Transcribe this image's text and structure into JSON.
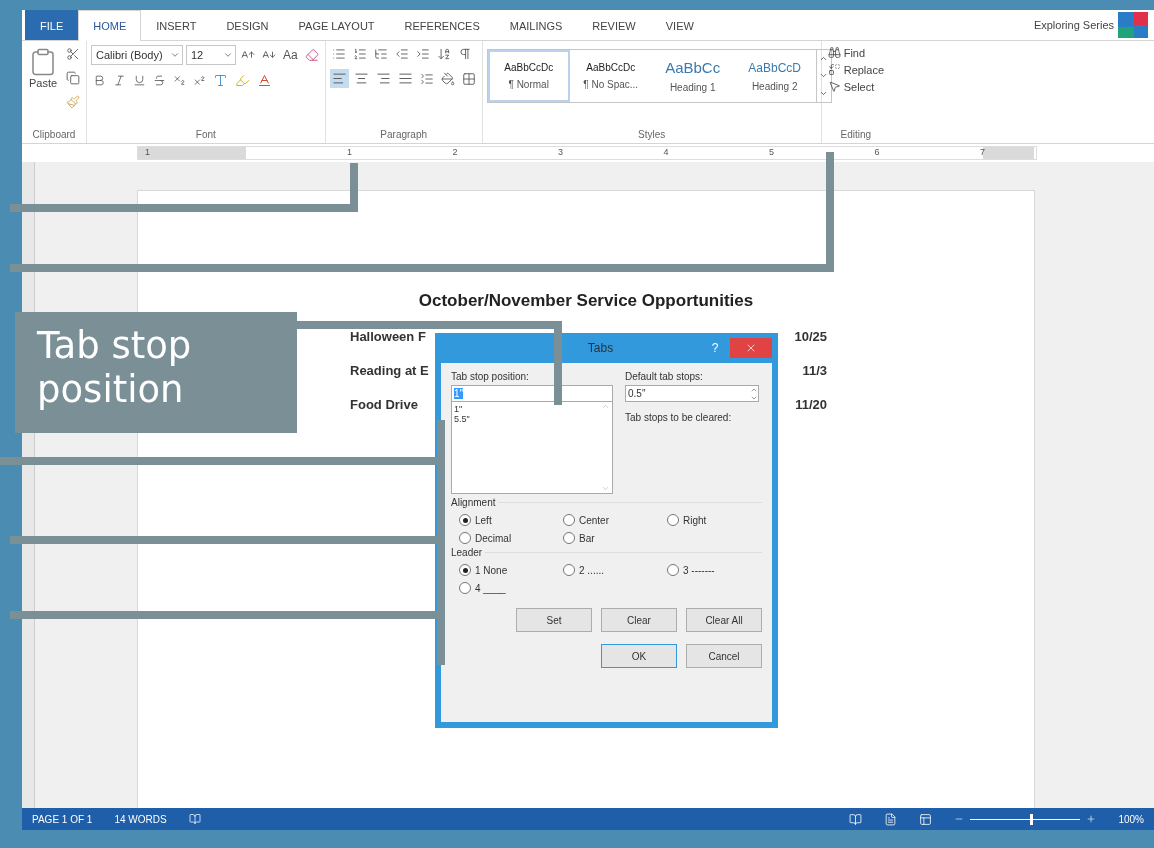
{
  "ribbon_tabs": [
    {
      "label": "FILE",
      "kind": "file",
      "selected": false
    },
    {
      "label": "HOME",
      "kind": "tab",
      "selected": true
    },
    {
      "label": "INSERT",
      "kind": "tab",
      "selected": false
    },
    {
      "label": "DESIGN",
      "kind": "tab",
      "selected": false
    },
    {
      "label": "PAGE LAYOUT",
      "kind": "tab",
      "selected": false
    },
    {
      "label": "REFERENCES",
      "kind": "tab",
      "selected": false
    },
    {
      "label": "MAILINGS",
      "kind": "tab",
      "selected": false
    },
    {
      "label": "REVIEW",
      "kind": "tab",
      "selected": false
    },
    {
      "label": "VIEW",
      "kind": "tab",
      "selected": false
    }
  ],
  "account": {
    "name": "Exploring Series"
  },
  "clipboard": {
    "paste_label": "Paste",
    "group_label": "Clipboard"
  },
  "font": {
    "family": "Calibri (Body)",
    "size": "12",
    "case_label": "Aa",
    "group_label": "Font"
  },
  "paragraph": {
    "group_label": "Paragraph",
    "align": [
      {
        "kind": "left",
        "selected": true
      },
      {
        "kind": "center",
        "selected": false
      },
      {
        "kind": "right",
        "selected": false
      },
      {
        "kind": "justify",
        "selected": false
      }
    ]
  },
  "styles": {
    "group_label": "Styles",
    "items": [
      {
        "preview": "AaBbCcDc",
        "name": "¶ Normal",
        "kind": "body",
        "selected": true
      },
      {
        "preview": "AaBbCcDc",
        "name": "¶ No Spac...",
        "kind": "body",
        "selected": false
      },
      {
        "preview": "AaBbCc",
        "name": "Heading 1",
        "kind": "heading1",
        "selected": false
      },
      {
        "preview": "AaBbCcD",
        "name": "Heading 2",
        "kind": "heading2",
        "selected": false
      }
    ]
  },
  "editing": {
    "group_label": "Editing",
    "items": [
      {
        "label": "Find",
        "kind": "find"
      },
      {
        "label": "Replace",
        "kind": "replace"
      },
      {
        "label": "Select",
        "kind": "select"
      }
    ]
  },
  "ruler": {
    "numbers": [
      "1",
      "1",
      "2",
      "3",
      "4",
      "5",
      "6",
      "7"
    ]
  },
  "document": {
    "title": "October/November Service Opportunities",
    "rows": [
      {
        "name": "Halloween F",
        "date": "10/25"
      },
      {
        "name": "Reading at E",
        "date": "11/3"
      },
      {
        "name": "Food Drive",
        "date": "11/20"
      }
    ]
  },
  "dialog": {
    "title": "Tabs",
    "help": "?",
    "position_label": "Tab stop position:",
    "position_value": "1\"",
    "positions": [
      "1\"",
      "5.5\""
    ],
    "default_label": "Default tab stops:",
    "default_value": "0.5\"",
    "clear_label": "Tab stops to be cleared:",
    "alignment": {
      "label": "Alignment",
      "options": [
        {
          "label": "Left",
          "selected": true
        },
        {
          "label": "Center",
          "selected": false
        },
        {
          "label": "Right",
          "selected": false
        },
        {
          "label": "Decimal",
          "selected": false
        },
        {
          "label": "Bar",
          "selected": false
        }
      ]
    },
    "leader": {
      "label": "Leader",
      "options": [
        {
          "label": "1 None",
          "selected": true
        },
        {
          "label": "2 ......",
          "selected": false
        },
        {
          "label": "3 -------",
          "selected": false
        },
        {
          "label": "4 ____",
          "selected": false
        }
      ]
    },
    "buttons": [
      {
        "label": "Set",
        "default": false
      },
      {
        "label": "Clear",
        "default": false
      },
      {
        "label": "Clear All",
        "default": false
      },
      {
        "label": "OK",
        "default": true
      },
      {
        "label": "Cancel",
        "default": false
      }
    ]
  },
  "callouts": [
    {
      "text": "Tab stop position"
    }
  ],
  "status_bar": {
    "page": "PAGE 1 OF 1",
    "words": "14 WORDS",
    "zoom": {
      "level": 0.55,
      "reading": "100%"
    }
  }
}
